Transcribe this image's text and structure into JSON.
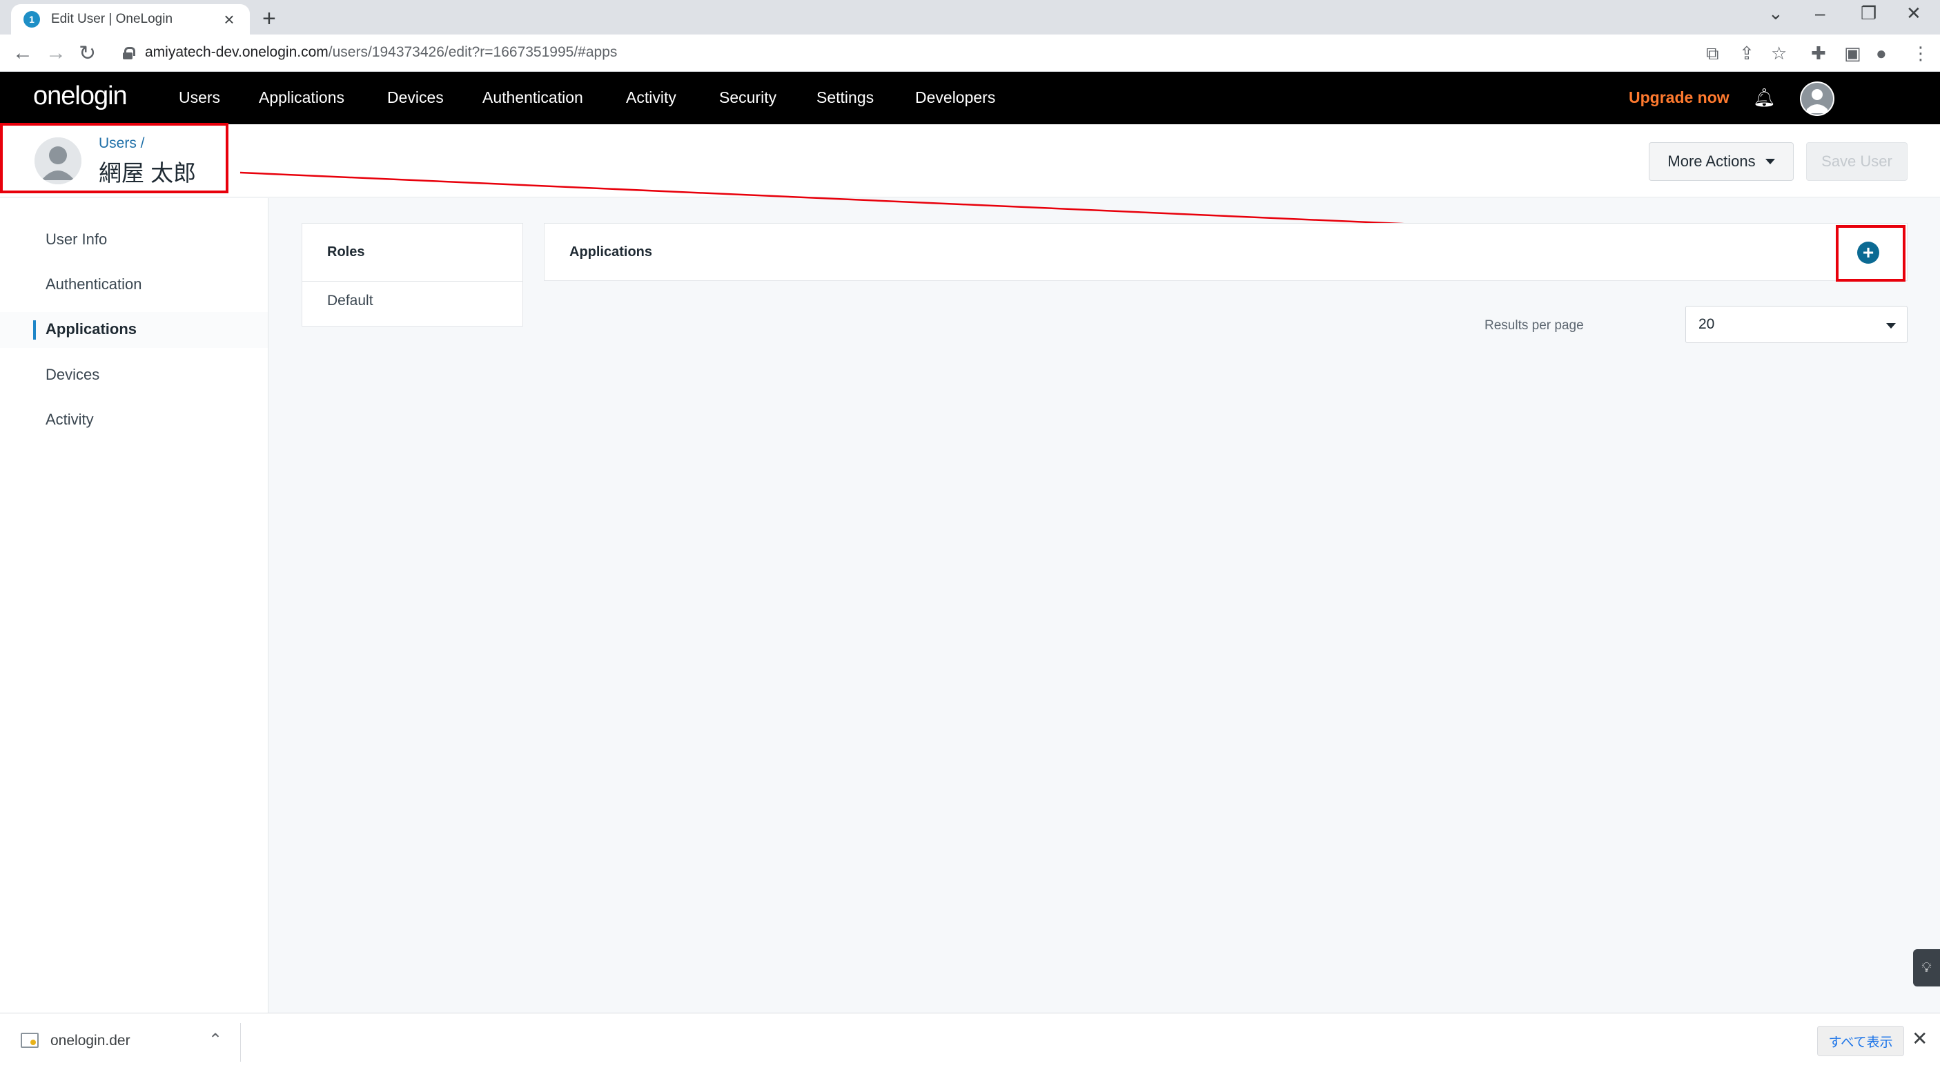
{
  "browser": {
    "tab_title": "Edit User | OneLogin",
    "tab_favicon": "1",
    "new_tab": "+",
    "url_host": "amiyatech-dev.onelogin.com",
    "url_path": "/users/194373426/edit?r=1667351995/#apps"
  },
  "topnav": {
    "logo": "onelogin",
    "links": [
      "Users",
      "Applications",
      "Devices",
      "Authentication",
      "Activity",
      "Security",
      "Settings",
      "Developers"
    ],
    "upgrade": "Upgrade now"
  },
  "header": {
    "breadcrumb": "Users /",
    "user_name": "網屋 太郎",
    "more_actions": "More Actions",
    "save_user": "Save User"
  },
  "sidebar": {
    "items": [
      "User Info",
      "Authentication",
      "Applications",
      "Devices",
      "Activity"
    ],
    "active": "Applications"
  },
  "roles": {
    "title": "Roles",
    "items": [
      "Default"
    ]
  },
  "applications": {
    "title": "Applications",
    "add_symbol": "+",
    "results_per_page_label": "Results per page",
    "results_per_page_value": "20"
  },
  "downloads": {
    "file_name": "onelogin.der",
    "show_all": "すべて表示"
  },
  "colors": {
    "accent": "#0b6a93",
    "highlight": "#e8000b",
    "upgrade": "#ff7a2f"
  }
}
